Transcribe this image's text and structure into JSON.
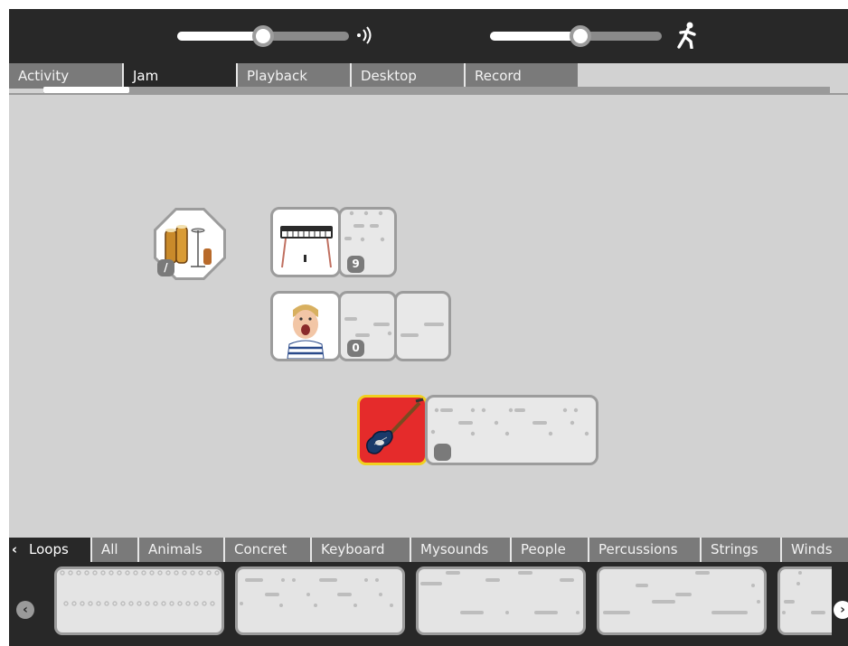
{
  "toolbar": {
    "volume": {
      "value": 0.5,
      "icon": "speaker-volume-icon"
    },
    "tempo": {
      "value": 0.5,
      "icon": "running-figure-icon"
    }
  },
  "tabs": [
    {
      "label": "Activity",
      "active": false
    },
    {
      "label": "Jam",
      "active": true
    },
    {
      "label": "Playback",
      "active": false
    },
    {
      "label": "Desktop",
      "active": false
    },
    {
      "label": "Record",
      "active": false
    }
  ],
  "instruments": {
    "drums": {
      "icon": "conga-drums-icon",
      "badge": "/"
    },
    "keyboard": {
      "icon": "electric-piano-icon",
      "badge": "9"
    },
    "voice": {
      "icon": "child-singing-icon",
      "badge": "0"
    },
    "guitar": {
      "icon": "bass-guitar-icon",
      "badge": "",
      "selected_color": "#e52b2b"
    }
  },
  "categories": [
    {
      "label": "Loops",
      "active": true
    },
    {
      "label": "All",
      "active": false
    },
    {
      "label": "Animals",
      "active": false
    },
    {
      "label": "Concret",
      "active": false
    },
    {
      "label": "Keyboard",
      "active": false
    },
    {
      "label": "Mysounds",
      "active": false
    },
    {
      "label": "People",
      "active": false
    },
    {
      "label": "Percussions",
      "active": false
    },
    {
      "label": "Strings",
      "active": false
    },
    {
      "label": "Winds",
      "active": false
    }
  ],
  "colors": {
    "toolbar_bg": "#282828",
    "canvas_bg": "#d2d2d2",
    "tab_inactive": "#7a7a7a",
    "selected_accent": "#f0d020"
  }
}
